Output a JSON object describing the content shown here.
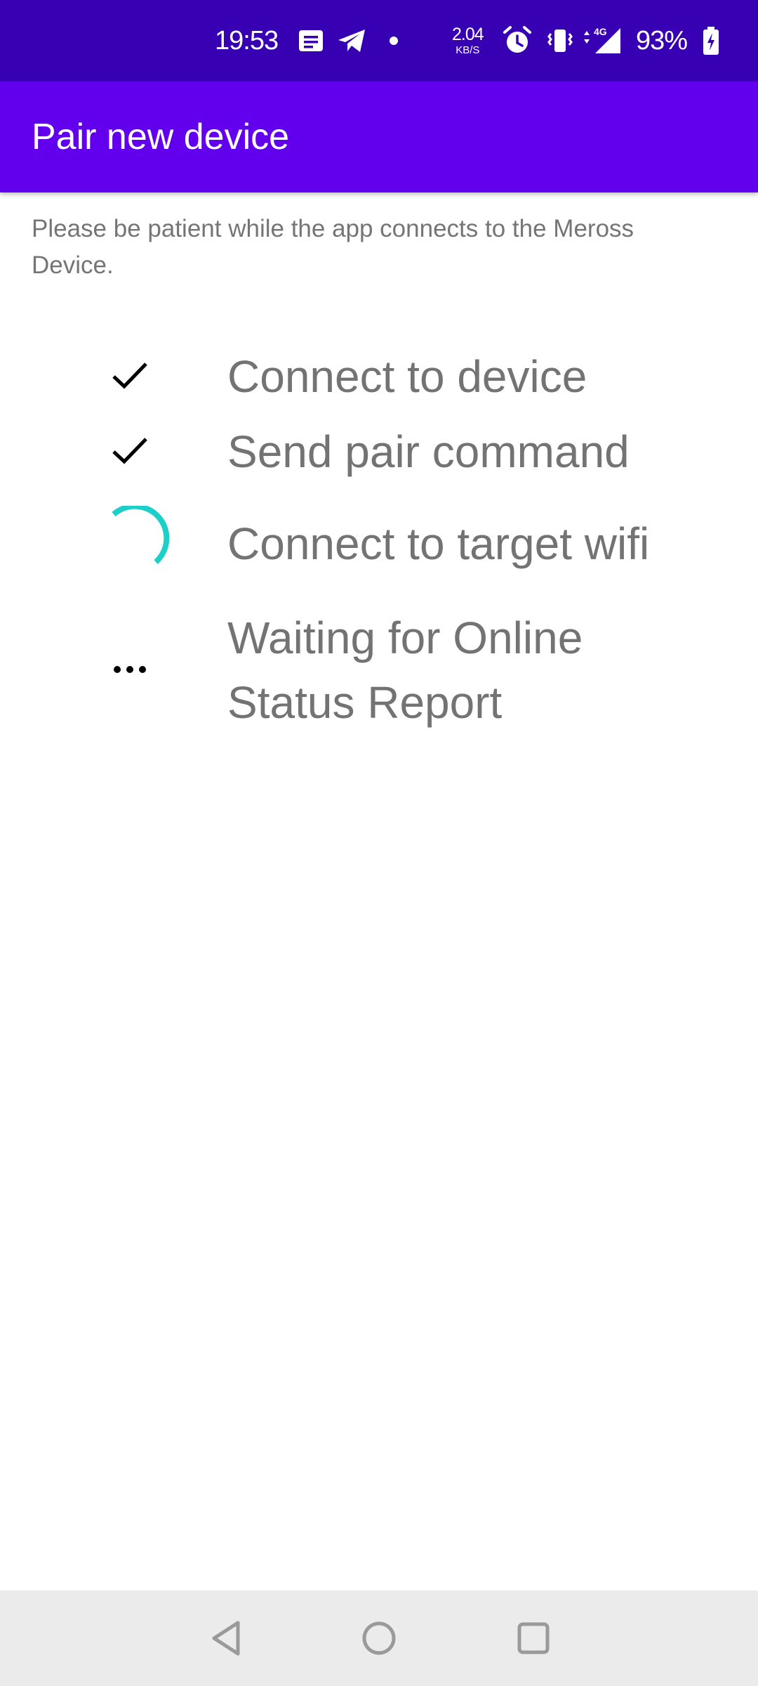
{
  "status_bar": {
    "time": "19:53",
    "net_speed": "2.04",
    "net_unit": "KB/S",
    "battery": "93%",
    "icons": [
      "message-icon",
      "telegram-icon",
      "dot-icon",
      "alarm-icon",
      "vibrate-icon",
      "signal-4g-icon",
      "battery-charging-icon"
    ],
    "background": "#3700b3"
  },
  "app_bar": {
    "title": "Pair new device",
    "background": "#6200ee"
  },
  "intro_text": "Please be patient while the app connects to the Meross Device.",
  "steps": [
    {
      "label": "Connect to device",
      "status": "done",
      "icon": "checkmark-icon"
    },
    {
      "label": "Send pair command",
      "status": "done",
      "icon": "checkmark-icon"
    },
    {
      "label": "Connect to target wifi",
      "status": "in-progress",
      "icon": "spinner-icon"
    },
    {
      "label": "Waiting for Online Status Report",
      "status": "pending",
      "icon": "ellipsis-icon"
    }
  ],
  "colors": {
    "spinner": "#1ccfc9",
    "step_text": "#737373"
  },
  "nav_bar": {
    "buttons": [
      "back-icon",
      "home-icon",
      "recents-icon"
    ]
  }
}
